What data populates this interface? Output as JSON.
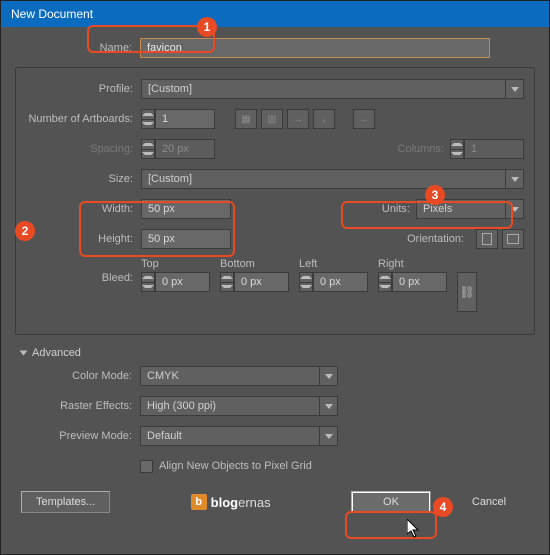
{
  "title": "New Document",
  "name": {
    "label": "Name:",
    "value": "favicon"
  },
  "profile": {
    "label": "Profile:",
    "value": "[Custom]"
  },
  "artboards": {
    "label": "Number of Artboards:",
    "value": "1"
  },
  "spacing": {
    "label": "Spacing:",
    "value": "20 px"
  },
  "columns": {
    "label": "Columns:",
    "value": "1"
  },
  "size": {
    "label": "Size:",
    "value": "[Custom]"
  },
  "width": {
    "label": "Width:",
    "value": "50 px"
  },
  "height": {
    "label": "Height:",
    "value": "50 px"
  },
  "units": {
    "label": "Units:",
    "value": "Pixels"
  },
  "orientation": {
    "label": "Orientation:"
  },
  "bleed": {
    "label": "Bleed:",
    "top_label": "Top",
    "top": "0 px",
    "bottom_label": "Bottom",
    "bottom": "0 px",
    "left_label": "Left",
    "left": "0 px",
    "right_label": "Right",
    "right": "0 px"
  },
  "advanced": {
    "label": "Advanced",
    "color_mode": {
      "label": "Color Mode:",
      "value": "CMYK"
    },
    "raster": {
      "label": "Raster Effects:",
      "value": "High (300 ppi)"
    },
    "preview": {
      "label": "Preview Mode:",
      "value": "Default"
    },
    "align_grid": "Align New Objects to Pixel Grid"
  },
  "buttons": {
    "templates": "Templates...",
    "ok": "OK",
    "cancel": "Cancel"
  },
  "brand": {
    "pre": "blog",
    "post": "ernas"
  },
  "callouts": {
    "b1": "1",
    "b2": "2",
    "b3": "3",
    "b4": "4"
  }
}
